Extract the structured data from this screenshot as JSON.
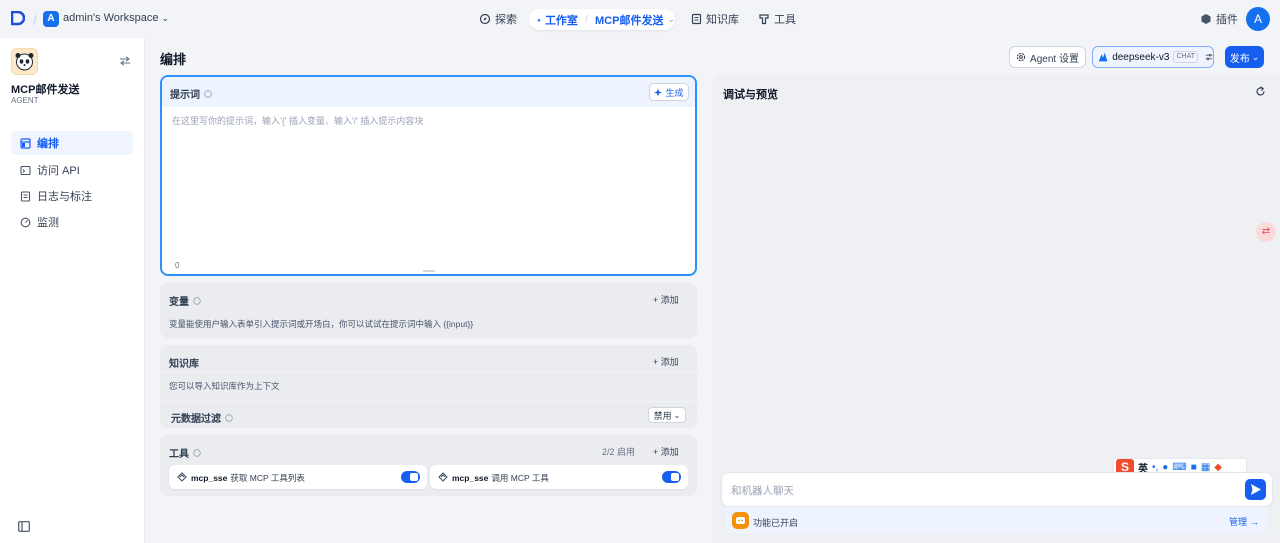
{
  "topbar": {
    "workspace_badge": "A",
    "workspace_name": "admin's Workspace",
    "nav": {
      "explore": "探索",
      "studio": "工作室",
      "app": "MCP邮件发送",
      "knowledge": "知识库",
      "tools": "工具"
    },
    "plugins": "插件",
    "avatar": "A"
  },
  "sidebar": {
    "app_name": "MCP邮件发送",
    "app_type": "AGENT",
    "items": [
      {
        "label": "编排",
        "icon": "layout-icon",
        "active": true
      },
      {
        "label": "访问 API",
        "icon": "terminal-icon",
        "active": false
      },
      {
        "label": "日志与标注",
        "icon": "file-list-icon",
        "active": false
      },
      {
        "label": "监测",
        "icon": "dashboard-icon",
        "active": false
      }
    ]
  },
  "main": {
    "title": "编排",
    "agent_settings": "Agent 设置",
    "model": {
      "name": "deepseek-v3",
      "tag": "CHAT"
    },
    "publish": "发布"
  },
  "prompt": {
    "title": "提示词",
    "generate": "生成",
    "placeholder": "在这里写你的提示词，输入'{' 插入变量、输入'/' 插入提示内容块",
    "count": "0"
  },
  "variables": {
    "title": "变量",
    "add": "+ 添加",
    "desc": "变量能使用户输入表单引入提示词或开场白，你可以试试在提示词中输入 {{input}}"
  },
  "knowledge": {
    "title": "知识库",
    "add": "+ 添加",
    "desc": "您可以导入知识库作为上下文",
    "metadata_filter": "元数据过滤",
    "metadata_value": "禁用"
  },
  "tools": {
    "title": "工具",
    "count": "2/2 启用",
    "add": "+ 添加",
    "items": [
      {
        "provider": "mcp_sse",
        "name": "获取 MCP 工具列表",
        "enabled": true
      },
      {
        "provider": "mcp_sse",
        "name": "调用 MCP 工具",
        "enabled": true
      }
    ]
  },
  "preview": {
    "title": "调试与预览",
    "input_placeholder": "和机器人聊天",
    "feature_status": "功能已开启",
    "manage": "管理"
  },
  "ime": {
    "lang": "英"
  },
  "colors": {
    "accent": "#155eef",
    "focus_border": "#2e90fa",
    "feature_icon": "#f79009"
  }
}
